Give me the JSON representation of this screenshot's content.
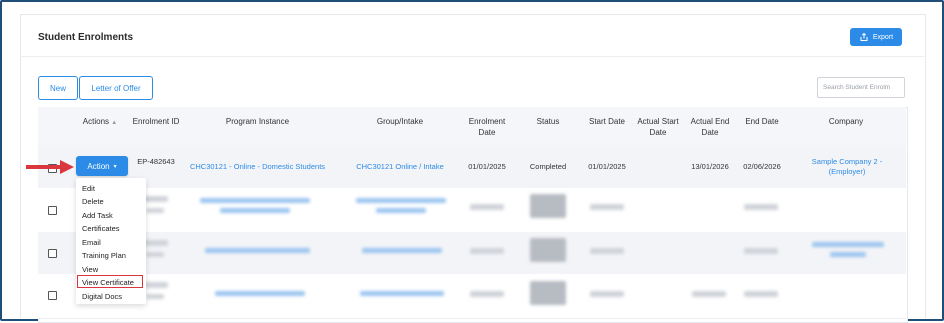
{
  "header": {
    "title": "Student Enrolments",
    "export_label": "Export"
  },
  "toolbar": {
    "new_label": "New",
    "letter_label": "Letter of Offer",
    "search_placeholder": "Search Student Enrolm"
  },
  "table": {
    "columns": {
      "actions": "Actions",
      "enrolment_id": "Enrolment ID",
      "program_instance": "Program Instance",
      "group_intake": "Group/Intake",
      "enrolment_date": "Enrolment Date",
      "status": "Status",
      "start_date": "Start Date",
      "actual_start_date": "Actual Start Date",
      "actual_end_date": "Actual End Date",
      "end_date": "End Date",
      "company": "Company"
    },
    "first_row": {
      "action_label": "Action",
      "enrolment_id": "EP-482643",
      "program_instance": "CHC30121 - Online - Domestic Students",
      "group_intake": "CHC30121 Online / Intake",
      "enrolment_date": "01/01/2025",
      "status": "Completed",
      "start_date": "01/01/2025",
      "actual_start_date": "",
      "actual_end_date": "13/01/2026",
      "end_date": "02/06/2026",
      "company": "Sample Company 2 - (Employer)"
    }
  },
  "action_menu": {
    "items": [
      "Edit",
      "Delete",
      "Add Task",
      "Certificates",
      "Email",
      "Training Plan",
      "View",
      "View Certificate",
      "Digital Docs"
    ],
    "highlighted": "View Certificate"
  },
  "colors": {
    "primary": "#2b8be6",
    "highlight": "#d9363e",
    "frame_border": "#1f4e79"
  }
}
